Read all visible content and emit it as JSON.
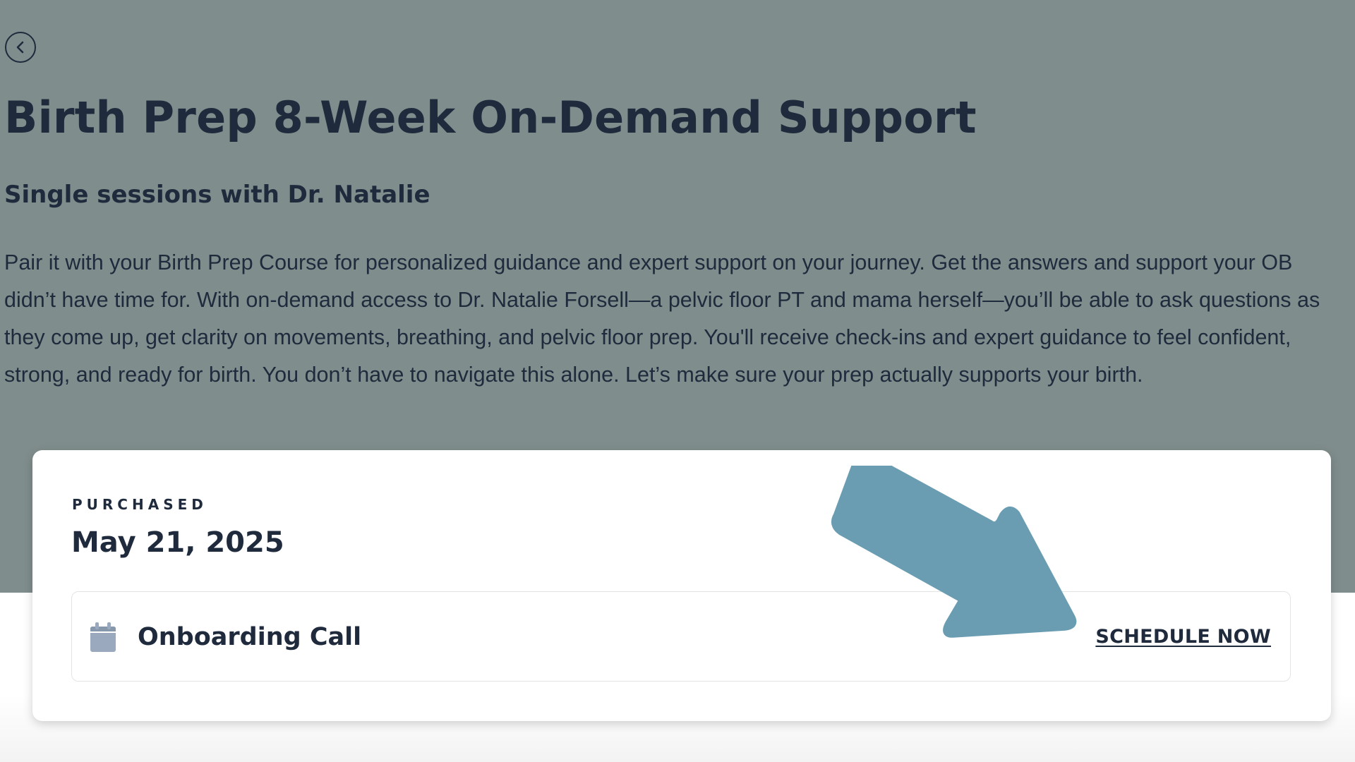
{
  "header": {
    "back_icon": "chevron-left-icon",
    "title": "Birth Prep 8-Week On-Demand Support",
    "subtitle": "Single sessions with Dr. Natalie",
    "description": "Pair it with your Birth Prep Course for personalized guidance and expert support on your journey. Get the answers and support your OB didn’t have time for. With on-demand access to Dr. Natalie Forsell—a pelvic floor PT and mama herself—you’ll be able to ask questions as they come up, get clarity on movements, breathing, and pelvic floor prep. You'll receive check-ins and expert guidance to feel confident, strong, and ready for birth. You don’t have to navigate this alone. Let’s make sure your prep actually supports your birth."
  },
  "purchase": {
    "label": "PURCHASED",
    "date": "May 21, 2025",
    "session": {
      "icon": "calendar-icon",
      "name": "Onboarding Call",
      "action_label": "SCHEDULE NOW"
    }
  },
  "colors": {
    "hero_background": "#7f8d8c",
    "text_primary": "#1f2b3d",
    "arrow": "#6b9db2",
    "calendar_icon": "#9aa9bd"
  }
}
